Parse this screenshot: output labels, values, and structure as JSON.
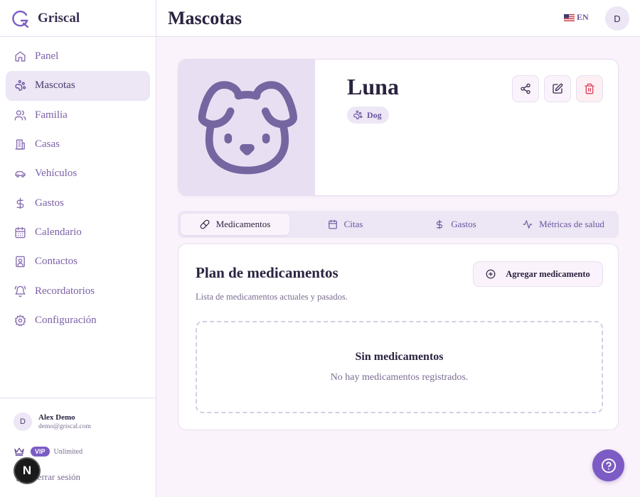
{
  "app": {
    "name": "Griscal"
  },
  "sidebar": {
    "items": [
      {
        "label": "Panel",
        "icon": "home-icon"
      },
      {
        "label": "Mascotas",
        "icon": "paw-icon",
        "active": true
      },
      {
        "label": "Familia",
        "icon": "users-icon"
      },
      {
        "label": "Casas",
        "icon": "building-icon"
      },
      {
        "label": "Vehículos",
        "icon": "car-icon"
      },
      {
        "label": "Gastos",
        "icon": "dollar-icon"
      },
      {
        "label": "Calendario",
        "icon": "calendar-icon"
      },
      {
        "label": "Contactos",
        "icon": "contact-icon"
      },
      {
        "label": "Recordatorios",
        "icon": "bell-icon"
      },
      {
        "label": "Configuración",
        "icon": "gear-icon"
      }
    ],
    "user": {
      "initial": "D",
      "name": "Alex Demo",
      "email": "demo@griscal.com"
    },
    "plan": {
      "badge": "VIP",
      "text": "Unlimited"
    },
    "logout_label": "Cerrar sesión"
  },
  "header": {
    "title": "Mascotas",
    "language": "EN",
    "avatar_initial": "D"
  },
  "pet": {
    "name": "Luna",
    "species": "Dog"
  },
  "tabs": [
    {
      "label": "Medicamentos",
      "icon": "link-icon",
      "active": true
    },
    {
      "label": "Citas",
      "icon": "calendar-icon"
    },
    {
      "label": "Gastos",
      "icon": "dollar-icon"
    },
    {
      "label": "Métricas de salud",
      "icon": "activity-icon"
    }
  ],
  "medications": {
    "title": "Plan de medicamentos",
    "subtitle": "Lista de medicamentos actuales y pasados.",
    "add_label": "Agregar medicamento",
    "empty_title": "Sin medicamentos",
    "empty_text": "No hay medicamentos registrados."
  },
  "dev_badge": "N",
  "colors": {
    "accent": "#7c5cc4",
    "danger": "#d9435b",
    "background": "#fbf3fb"
  }
}
